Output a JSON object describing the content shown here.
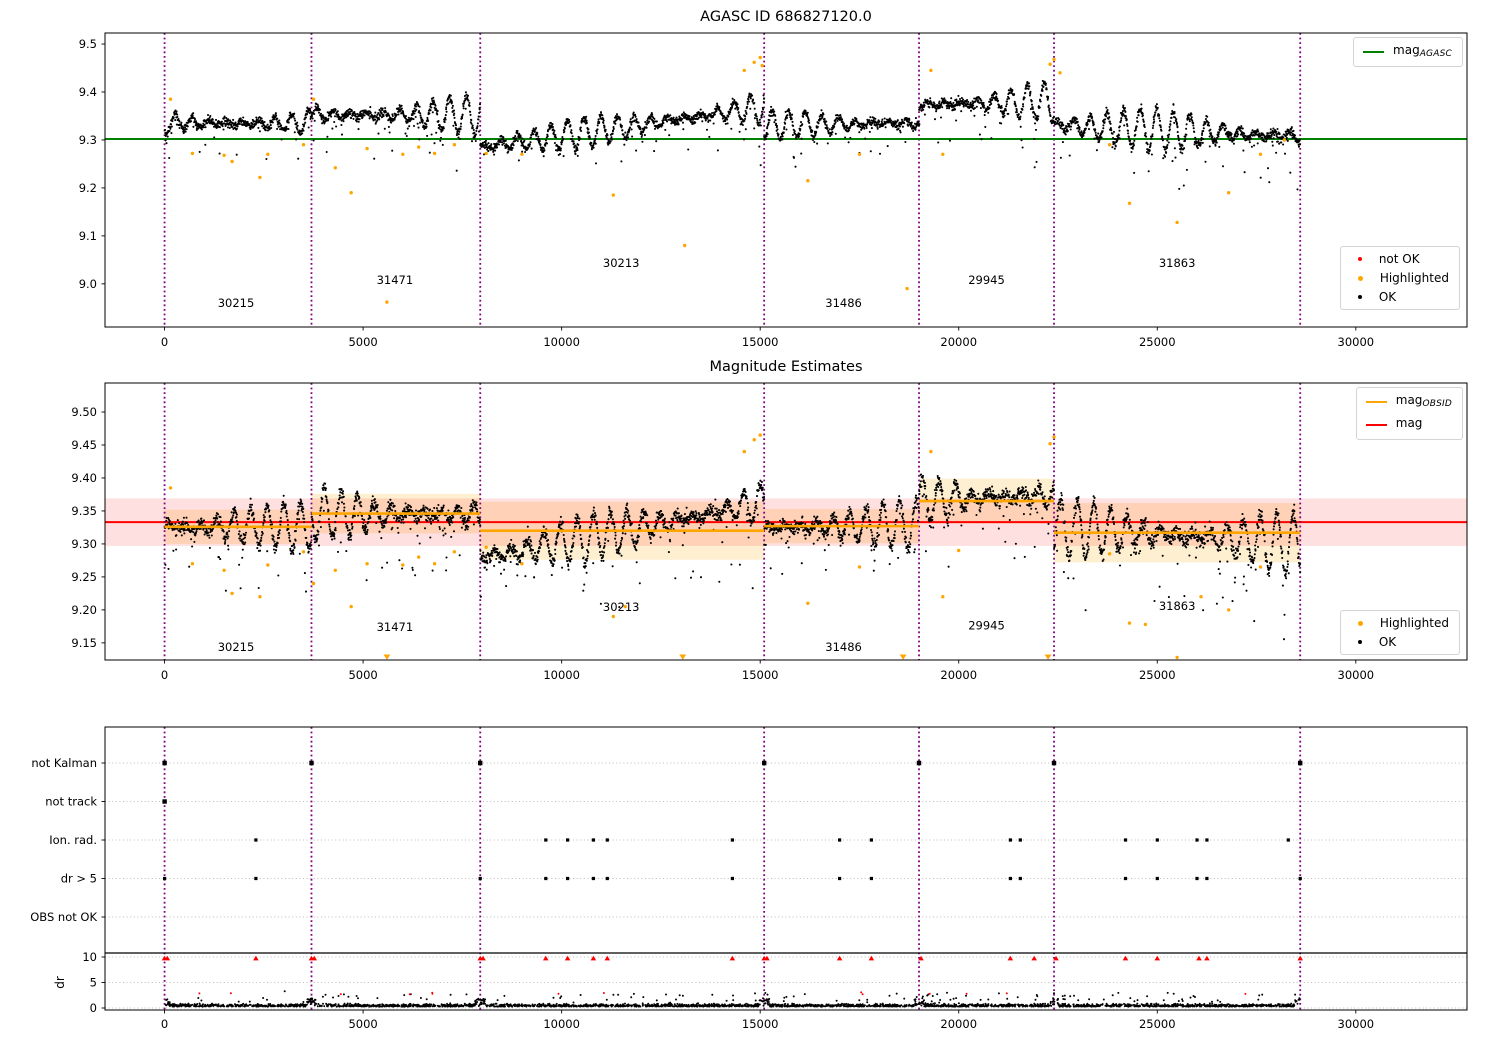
{
  "colors": {
    "green": "#008000",
    "orange": "#FFA500",
    "red": "#FF0000",
    "purple": "#800080",
    "black": "#000000",
    "grid": "#bbbbbb",
    "band_red": "rgba(255,0,0,0.12)",
    "band_orange": "rgba(255,165,0,0.18)"
  },
  "chart_data": [
    {
      "id": "top",
      "type": "scatter",
      "title": "AGASC ID 686827120.0",
      "xlim": [
        -1500,
        32800
      ],
      "xticks": [
        "0",
        "5000",
        "10000",
        "15000",
        "20000",
        "25000",
        "30000"
      ],
      "xtick_values": [
        0,
        5000,
        10000,
        15000,
        20000,
        25000,
        30000
      ],
      "ylim": [
        8.91,
        9.523
      ],
      "yticks": [
        "9.5",
        "9.4",
        "9.3",
        "9.2",
        "9.1",
        "9.0"
      ],
      "ytick_values": [
        9.5,
        9.4,
        9.3,
        9.2,
        9.1,
        9.0
      ],
      "mag_agasc": 9.302,
      "boundaries": [
        0,
        3700,
        7950,
        15100,
        19000,
        22400,
        28600
      ],
      "legend_line": {
        "main": "mag",
        "sub": "AGASC"
      },
      "legend_status": {
        "items": [
          {
            "label": "not OK",
            "color": "red"
          },
          {
            "label": "Highlighted",
            "color": "orange"
          },
          {
            "label": "OK",
            "color": "black"
          }
        ]
      },
      "outliers": [
        [
          150,
          9.385
        ],
        [
          700,
          9.272
        ],
        [
          1500,
          9.268
        ],
        [
          1700,
          9.255
        ],
        [
          2400,
          9.222
        ],
        [
          2600,
          9.27
        ],
        [
          3500,
          9.29
        ],
        [
          3750,
          9.385
        ],
        [
          4300,
          9.242
        ],
        [
          4700,
          9.19
        ],
        [
          5100,
          9.282
        ],
        [
          5600,
          8.962
        ],
        [
          6000,
          9.27
        ],
        [
          6400,
          9.285
        ],
        [
          6800,
          9.272
        ],
        [
          7300,
          9.29
        ],
        [
          8100,
          9.272
        ],
        [
          9000,
          9.27
        ],
        [
          11300,
          9.185
        ],
        [
          13100,
          9.08
        ],
        [
          14600,
          9.445
        ],
        [
          14850,
          9.462
        ],
        [
          15000,
          9.472
        ],
        [
          15050,
          9.455
        ],
        [
          16200,
          9.215
        ],
        [
          17500,
          9.27
        ],
        [
          18700,
          8.99
        ],
        [
          19300,
          9.445
        ],
        [
          19600,
          9.27
        ],
        [
          22300,
          9.458
        ],
        [
          22400,
          9.468
        ],
        [
          22550,
          9.44
        ],
        [
          23800,
          9.29
        ],
        [
          24300,
          9.168
        ],
        [
          25500,
          9.128
        ],
        [
          26800,
          9.19
        ],
        [
          27600,
          9.27
        ],
        [
          28200,
          9.3
        ]
      ]
    },
    {
      "id": "middle",
      "type": "scatter",
      "title": "Magnitude Estimates",
      "xlim": [
        -1500,
        32800
      ],
      "xticks": [
        "0",
        "5000",
        "10000",
        "15000",
        "20000",
        "25000",
        "30000"
      ],
      "xtick_values": [
        0,
        5000,
        10000,
        15000,
        20000,
        25000,
        30000
      ],
      "ylim": [
        9.124,
        9.544
      ],
      "yticks": [
        "9.50",
        "9.45",
        "9.40",
        "9.35",
        "9.30",
        "9.25",
        "9.20",
        "9.15"
      ],
      "ytick_values": [
        9.5,
        9.45,
        9.4,
        9.35,
        9.3,
        9.25,
        9.2,
        9.15
      ],
      "mag": 9.333,
      "mag_band": [
        9.297,
        9.369
      ],
      "boundaries": [
        0,
        3700,
        7950,
        15100,
        19000,
        22400,
        28600
      ],
      "legend_lines": {
        "items": [
          {
            "main": "mag",
            "sub": "OBSID",
            "color": "orange"
          },
          {
            "main": "mag",
            "sub": "",
            "color": "red"
          }
        ]
      },
      "legend_status": {
        "items": [
          {
            "label": "Highlighted",
            "color": "orange"
          },
          {
            "label": "OK",
            "color": "black"
          }
        ]
      },
      "clipped_low_x": [
        5600,
        13050,
        18600,
        22250
      ],
      "outliers": [
        [
          150,
          9.385
        ],
        [
          700,
          9.27
        ],
        [
          1500,
          9.26
        ],
        [
          1700,
          9.225
        ],
        [
          2400,
          9.22
        ],
        [
          2600,
          9.268
        ],
        [
          3500,
          9.288
        ],
        [
          3750,
          9.24
        ],
        [
          4300,
          9.26
        ],
        [
          4700,
          9.205
        ],
        [
          5100,
          9.27
        ],
        [
          6000,
          9.268
        ],
        [
          6400,
          9.28
        ],
        [
          6800,
          9.27
        ],
        [
          7300,
          9.288
        ],
        [
          8100,
          9.295
        ],
        [
          9000,
          9.27
        ],
        [
          11300,
          9.19
        ],
        [
          11600,
          9.205
        ],
        [
          14600,
          9.44
        ],
        [
          14850,
          9.458
        ],
        [
          15000,
          9.465
        ],
        [
          16200,
          9.21
        ],
        [
          17500,
          9.265
        ],
        [
          19300,
          9.44
        ],
        [
          19600,
          9.22
        ],
        [
          20000,
          9.29
        ],
        [
          22300,
          9.452
        ],
        [
          22400,
          9.462
        ],
        [
          23800,
          9.285
        ],
        [
          24300,
          9.18
        ],
        [
          24700,
          9.178
        ],
        [
          25500,
          9.128
        ],
        [
          26100,
          9.22
        ],
        [
          26800,
          9.2
        ],
        [
          27600,
          9.265
        ]
      ]
    },
    {
      "id": "bottom",
      "type": "scatter",
      "xlim": [
        -1500,
        32800
      ],
      "xticks": [
        "0",
        "5000",
        "10000",
        "15000",
        "20000",
        "25000",
        "30000"
      ],
      "xtick_values": [
        0,
        5000,
        10000,
        15000,
        20000,
        25000,
        30000
      ],
      "boundaries": [
        0,
        3700,
        7950,
        15100,
        19000,
        22400,
        28600
      ],
      "flag_rows": [
        {
          "label": "not Kalman",
          "xs": [
            0,
            3700,
            7950,
            15100,
            19000,
            22400,
            28600
          ],
          "size": 4.4
        },
        {
          "label": "not track",
          "xs": [
            0
          ],
          "size": 4.4
        },
        {
          "label": "Ion. rad.",
          "xs": [
            2300,
            9600,
            10150,
            10800,
            11150,
            14300,
            17000,
            17800,
            21300,
            21550,
            24200,
            25000,
            26000,
            26250,
            28300
          ],
          "size": 3.2
        },
        {
          "label": "dr > 5",
          "xs": [
            0,
            2300,
            7950,
            9600,
            10150,
            10800,
            11150,
            14300,
            17000,
            17800,
            21300,
            21550,
            24200,
            25000,
            26000,
            26250,
            28600
          ],
          "size": 3.2
        },
        {
          "label": "OBS not OK",
          "xs": [],
          "size": 3.2
        }
      ],
      "dr": {
        "ylabel": "dr",
        "ticks": [
          "10",
          "5",
          "0"
        ],
        "tick_values": [
          10,
          5,
          0
        ],
        "clip_value": 10,
        "clipped_x": [
          0,
          70,
          2300,
          3700,
          3770,
          7950,
          8020,
          9600,
          10150,
          10800,
          11150,
          14300,
          15100,
          15170,
          17000,
          17800,
          19050,
          21300,
          21900,
          22450,
          24200,
          25000,
          26050,
          26250,
          28600
        ],
        "n": 2900,
        "xmax": 28600,
        "base": 0.28,
        "spread": 0.6,
        "spike_chance": 0.045,
        "max": 4.6
      }
    }
  ],
  "segments": [
    {
      "obsid": "30215",
      "x0": 0,
      "x1": 3700,
      "top": {
        "c0": 9.335,
        "c1": 9.335,
        "amp0": 0.03,
        "amp1": 0.034,
        "noise": 0.011
      },
      "mid": {
        "c0": 9.326,
        "c1": 9.326,
        "amp0": 0.032,
        "amp1": 0.036,
        "noise": 0.012
      },
      "mag_obsid": 9.326,
      "band": [
        9.3,
        9.352
      ],
      "label_x": 1800,
      "top_label_mag": 8.952,
      "mid_label_mag": 9.138
    },
    {
      "obsid": "31471",
      "x0": 3700,
      "x1": 7950,
      "top": {
        "c0": 9.352,
        "c1": 9.352,
        "amp0": 0.036,
        "amp1": 0.04,
        "noise": 0.012
      },
      "mid": {
        "c0": 9.345,
        "c1": 9.345,
        "amp0": 0.038,
        "amp1": 0.042,
        "noise": 0.013
      },
      "mag_obsid": 9.346,
      "band": [
        9.316,
        9.376
      ],
      "label_x": 5800,
      "top_label_mag": 9.0,
      "mid_label_mag": 9.168
    },
    {
      "obsid": "30213",
      "x0": 7950,
      "x1": 15100,
      "top": {
        "c0": 9.285,
        "c1": 9.368,
        "amp0": 0.022,
        "amp1": 0.05,
        "noise": 0.011
      },
      "mid": {
        "c0": 9.278,
        "c1": 9.362,
        "amp0": 0.024,
        "amp1": 0.052,
        "noise": 0.012
      },
      "mag_obsid": 9.32,
      "band": [
        9.276,
        9.364
      ],
      "label_x": 11500,
      "top_label_mag": 9.035,
      "mid_label_mag": 9.198
    },
    {
      "obsid": "31486",
      "x0": 15100,
      "x1": 19000,
      "top": {
        "c0": 9.33,
        "c1": 9.336,
        "amp0": 0.03,
        "amp1": 0.034,
        "noise": 0.011
      },
      "mid": {
        "c0": 9.324,
        "c1": 9.33,
        "amp0": 0.032,
        "amp1": 0.036,
        "noise": 0.012
      },
      "mag_obsid": 9.327,
      "band": [
        9.301,
        9.353
      ],
      "label_x": 17100,
      "top_label_mag": 8.952,
      "mid_label_mag": 9.138
    },
    {
      "obsid": "29945",
      "x0": 19000,
      "x1": 22400,
      "top": {
        "c0": 9.372,
        "c1": 9.38,
        "amp0": 0.038,
        "amp1": 0.044,
        "noise": 0.012
      },
      "mid": {
        "c0": 9.366,
        "c1": 9.374,
        "amp0": 0.04,
        "amp1": 0.046,
        "noise": 0.013
      },
      "mag_obsid": 9.365,
      "band": [
        9.331,
        9.399
      ],
      "label_x": 20700,
      "top_label_mag": 9.0,
      "mid_label_mag": 9.17
    },
    {
      "obsid": "31863",
      "x0": 22400,
      "x1": 28600,
      "top": {
        "c0": 9.332,
        "c1": 9.306,
        "amp0": 0.042,
        "amp1": 0.048,
        "noise": 0.013
      },
      "mid": {
        "c0": 9.326,
        "c1": 9.3,
        "amp0": 0.044,
        "amp1": 0.05,
        "noise": 0.014
      },
      "mag_obsid": 9.317,
      "band": [
        9.272,
        9.362
      ],
      "label_x": 25500,
      "top_label_mag": 9.035,
      "mid_label_mag": 9.2
    }
  ]
}
